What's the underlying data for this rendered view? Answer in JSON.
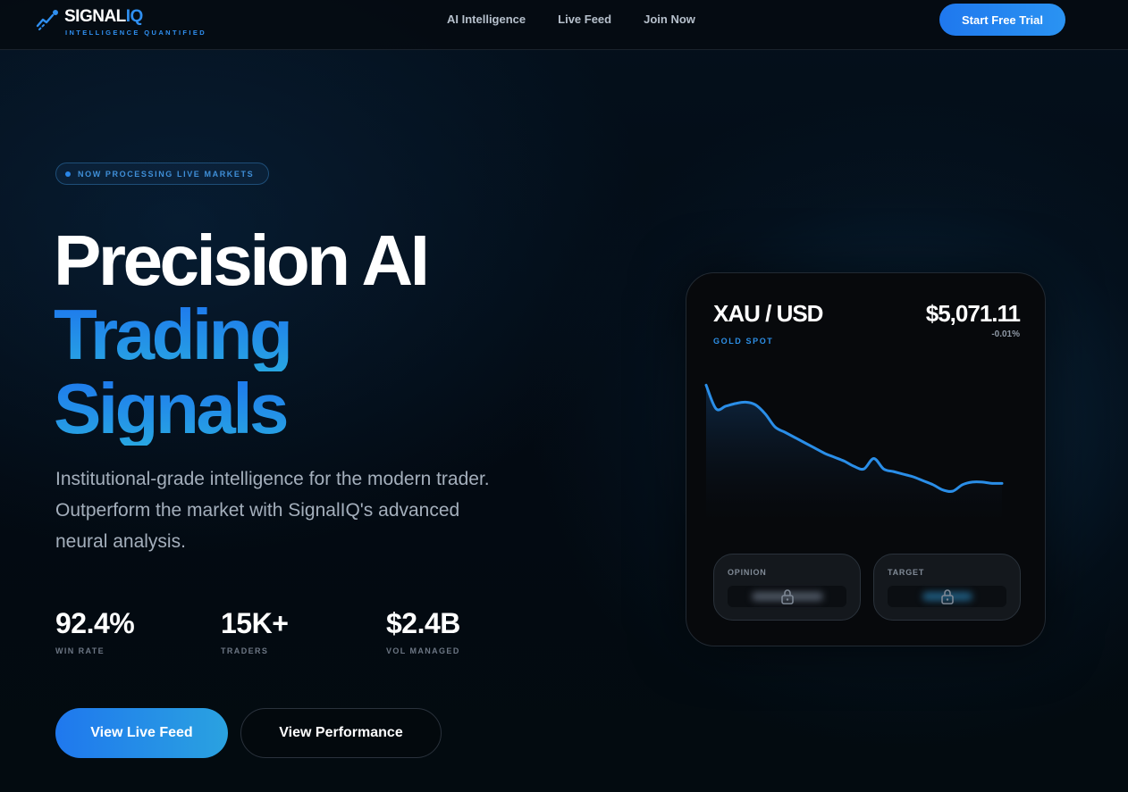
{
  "nav": {
    "brand_main": "SIGNAL",
    "brand_accent": "IQ",
    "tagline": "INTELLIGENCE QUANTIFIED",
    "links": [
      "AI Intelligence",
      "Live Feed",
      "Join Now"
    ],
    "cta_label": "Start Free Trial"
  },
  "hero": {
    "badge": "NOW PROCESSING LIVE MARKETS",
    "headline_line1": "Precision AI",
    "headline_line2": "Trading",
    "headline_line3": "Signals",
    "subtitle": "Institutional-grade intelligence for the modern trader. Outperform the market with SignalIQ's advanced neural analysis.",
    "stats": [
      {
        "value": "92.4%",
        "label": "WIN RATE"
      },
      {
        "value": "15K+",
        "label": "TRADERS"
      },
      {
        "value": "$2.4B",
        "label": "VOL MANAGED"
      }
    ],
    "primary_button": "View Live Feed",
    "secondary_button": "View Performance"
  },
  "card": {
    "pair": "XAU / USD",
    "pair_sub": "GOLD SPOT",
    "price": "$5,071.11",
    "change": "-0.01%",
    "opinion_label": "OPINION",
    "target_label": "TARGET",
    "lock_icon": "lock-icon"
  },
  "chart_data": {
    "type": "line",
    "x": [
      0,
      1,
      2,
      3,
      4,
      5,
      6,
      7,
      8,
      9,
      10,
      11,
      12,
      13,
      14,
      15,
      16,
      17,
      18,
      19,
      20,
      21,
      22,
      23,
      24,
      25,
      26,
      27,
      28,
      29,
      30
    ],
    "series": [
      {
        "values": [
          100,
          82,
          84,
          86,
          87,
          85,
          78,
          68,
          64,
          60,
          56,
          52,
          48,
          45,
          42,
          38,
          36,
          44,
          36,
          34,
          32,
          30,
          27,
          24,
          20,
          19,
          24,
          26,
          26,
          25,
          25
        ]
      }
    ],
    "ylim": [
      0,
      105
    ],
    "colors": {
      "line": "#2a8ee8"
    },
    "grid": false
  },
  "colors": {
    "accent": "#2f8ff0",
    "gradient_start": "#1d75ee",
    "gradient_end": "#28a6e2"
  }
}
